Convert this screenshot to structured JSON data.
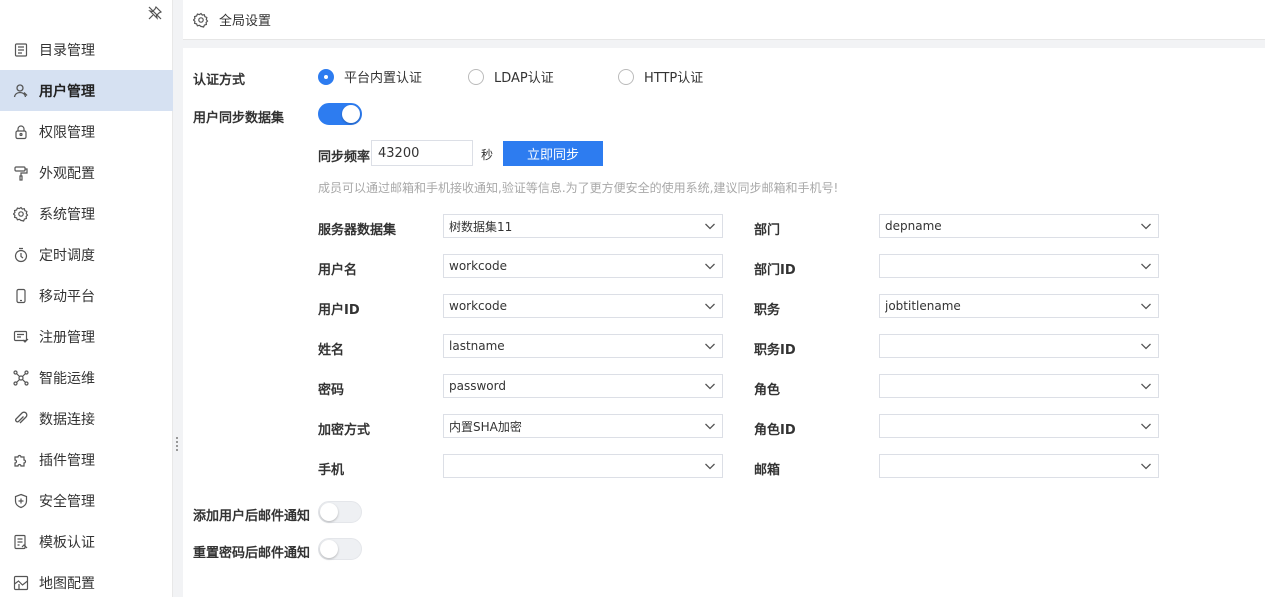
{
  "sidebar": {
    "items": [
      {
        "label": "目录管理",
        "icon": "catalog-icon",
        "active": false
      },
      {
        "label": "用户管理",
        "icon": "user-icon",
        "active": true
      },
      {
        "label": "权限管理",
        "icon": "lock-icon",
        "active": false
      },
      {
        "label": "外观配置",
        "icon": "paint-roller-icon",
        "active": false
      },
      {
        "label": "系统管理",
        "icon": "gear-icon",
        "active": false
      },
      {
        "label": "定时调度",
        "icon": "timer-icon",
        "active": false
      },
      {
        "label": "移动平台",
        "icon": "mobile-icon",
        "active": false
      },
      {
        "label": "注册管理",
        "icon": "register-icon",
        "active": false
      },
      {
        "label": "智能运维",
        "icon": "network-icon",
        "active": false
      },
      {
        "label": "数据连接",
        "icon": "link-icon",
        "active": false
      },
      {
        "label": "插件管理",
        "icon": "puzzle-icon",
        "active": false
      },
      {
        "label": "安全管理",
        "icon": "shield-icon",
        "active": false
      },
      {
        "label": "模板认证",
        "icon": "template-icon",
        "active": false
      },
      {
        "label": "地图配置",
        "icon": "map-icon",
        "active": false
      }
    ]
  },
  "header": {
    "title": "全局设置",
    "icon": "gear-icon"
  },
  "auth": {
    "label": "认证方式",
    "options": [
      {
        "label": "平台内置认证",
        "checked": true
      },
      {
        "label": "LDAP认证",
        "checked": false
      },
      {
        "label": "HTTP认证",
        "checked": false
      }
    ]
  },
  "sync": {
    "label": "用户同步数据集",
    "enabled": true,
    "freq_label": "同步频率",
    "freq_value": "43200",
    "freq_unit": "秒",
    "sync_button": "立即同步",
    "hint": "成员可以通过邮箱和手机接收通知,验证等信息.为了更方便安全的使用系统,建议同步邮箱和手机号!"
  },
  "fields_left": [
    {
      "label": "服务器数据集",
      "value": "树数据集11"
    },
    {
      "label": "用户名",
      "value": "workcode"
    },
    {
      "label": "用户ID",
      "value": "workcode"
    },
    {
      "label": "姓名",
      "value": "lastname"
    },
    {
      "label": "密码",
      "value": "password"
    },
    {
      "label": "加密方式",
      "value": "内置SHA加密"
    },
    {
      "label": "手机",
      "value": ""
    }
  ],
  "fields_right": [
    {
      "label": "部门",
      "value": "depname"
    },
    {
      "label": "部门ID",
      "value": ""
    },
    {
      "label": "职务",
      "value": "jobtitlename"
    },
    {
      "label": "职务ID",
      "value": ""
    },
    {
      "label": "角色",
      "value": ""
    },
    {
      "label": "角色ID",
      "value": ""
    },
    {
      "label": "邮箱",
      "value": ""
    }
  ],
  "notify_add": {
    "label": "添加用户后邮件通知",
    "enabled": false
  },
  "notify_reset": {
    "label": "重置密码后邮件通知",
    "enabled": false
  },
  "colors": {
    "accent": "#2d7cf0",
    "active_nav_bg": "#d6e1f2",
    "hint": "#a8a8a8"
  }
}
